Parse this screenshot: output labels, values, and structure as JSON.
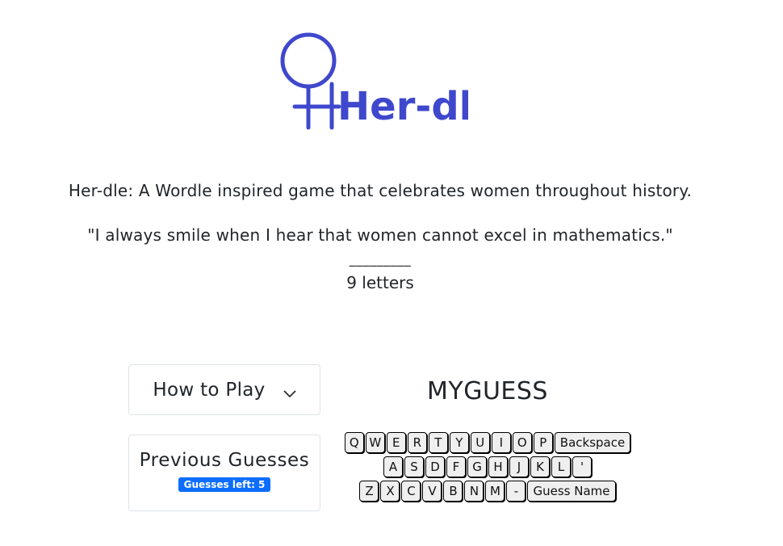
{
  "logo": {
    "text": "Her-dle",
    "color": "#3f48cc"
  },
  "tagline": "Her-dle: A Wordle inspired game that celebrates women throughout history.",
  "quote": "\"I always smile when I hear that women cannot excel in mathematics.\"",
  "blanks": "_________",
  "letters_count": "9 letters",
  "how_to_play": {
    "label": "How to Play",
    "icon": "chevron-down-icon"
  },
  "previous_guesses": {
    "title": "Previous Guesses",
    "badge": "Guesses left: 5",
    "badge_color": "#0d6efd"
  },
  "current_guess": "MYGUESS",
  "keyboard": {
    "row1": [
      "Q",
      "W",
      "E",
      "R",
      "T",
      "Y",
      "U",
      "I",
      "O",
      "P",
      "Backspace"
    ],
    "row2": [
      "A",
      "S",
      "D",
      "F",
      "G",
      "H",
      "J",
      "K",
      "L",
      "'"
    ],
    "row3": [
      "Z",
      "X",
      "C",
      "V",
      "B",
      "N",
      "M",
      "-",
      "Guess Name"
    ]
  }
}
